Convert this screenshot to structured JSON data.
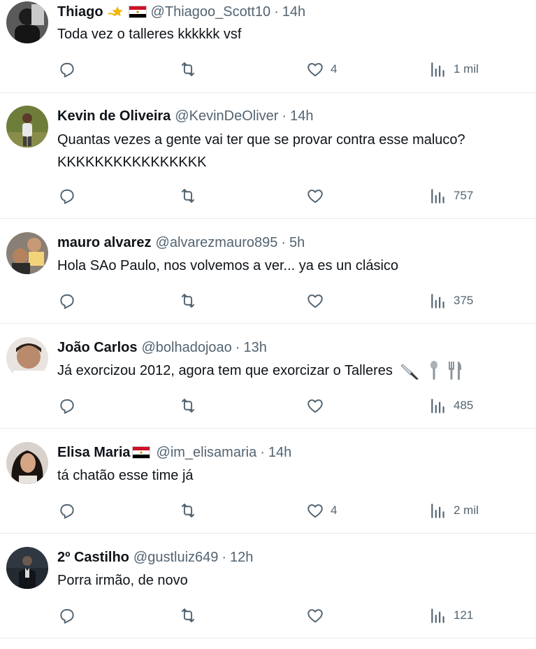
{
  "tweets": [
    {
      "name": "Thiago",
      "handle": "@Thiagoo_Scott10",
      "time": "14h",
      "text": [
        "Toda vez o talleres kkkkkk vsf"
      ],
      "likes": "4",
      "views": "1 mil",
      "name_badges": [
        "sparkle-star-emoji",
        "egypt-flag-emoji"
      ]
    },
    {
      "name": "Kevin de Oliveira",
      "handle": "@KevinDeOliver",
      "time": "14h",
      "text": [
        "Quantas vezes a gente vai ter que se provar contra esse maluco?",
        "KKKKKKKKKKKKKKKK"
      ],
      "likes": "",
      "views": "757"
    },
    {
      "name": "mauro alvarez",
      "handle": "@alvarezmauro895",
      "time": "5h",
      "text": [
        "Hola SAo Paulo, nos volvemos a ver... ya es un clásico"
      ],
      "likes": "",
      "views": "375"
    },
    {
      "name": "João Carlos",
      "handle": "@bolhadojoao",
      "time": "13h",
      "text": [
        "Já exorcizou 2012, agora tem que exorcizar o Talleres"
      ],
      "text_emojis": [
        "knife-emoji",
        "spoon-emoji",
        "fork-knife-emoji"
      ],
      "likes": "",
      "views": "485"
    },
    {
      "name": "Elisa Maria",
      "handle": "@im_elisamaria",
      "time": "14h",
      "text": [
        "tá chatão esse time já"
      ],
      "likes": "4",
      "views": "2 mil",
      "name_badges": [
        "egypt-flag-emoji"
      ]
    },
    {
      "name": "2º Castilho",
      "handle": "@gustluiz649",
      "time": "12h",
      "text": [
        "Porra irmão, de novo"
      ],
      "likes": "",
      "views": "121"
    }
  ],
  "separator": "·",
  "icons": {
    "reply": "reply-icon",
    "retweet": "retweet-icon",
    "like": "heart-icon",
    "views": "views-chart-icon"
  },
  "colors": {
    "text": "#0f1419",
    "muted": "#536471",
    "divider": "#e6ecf0"
  }
}
